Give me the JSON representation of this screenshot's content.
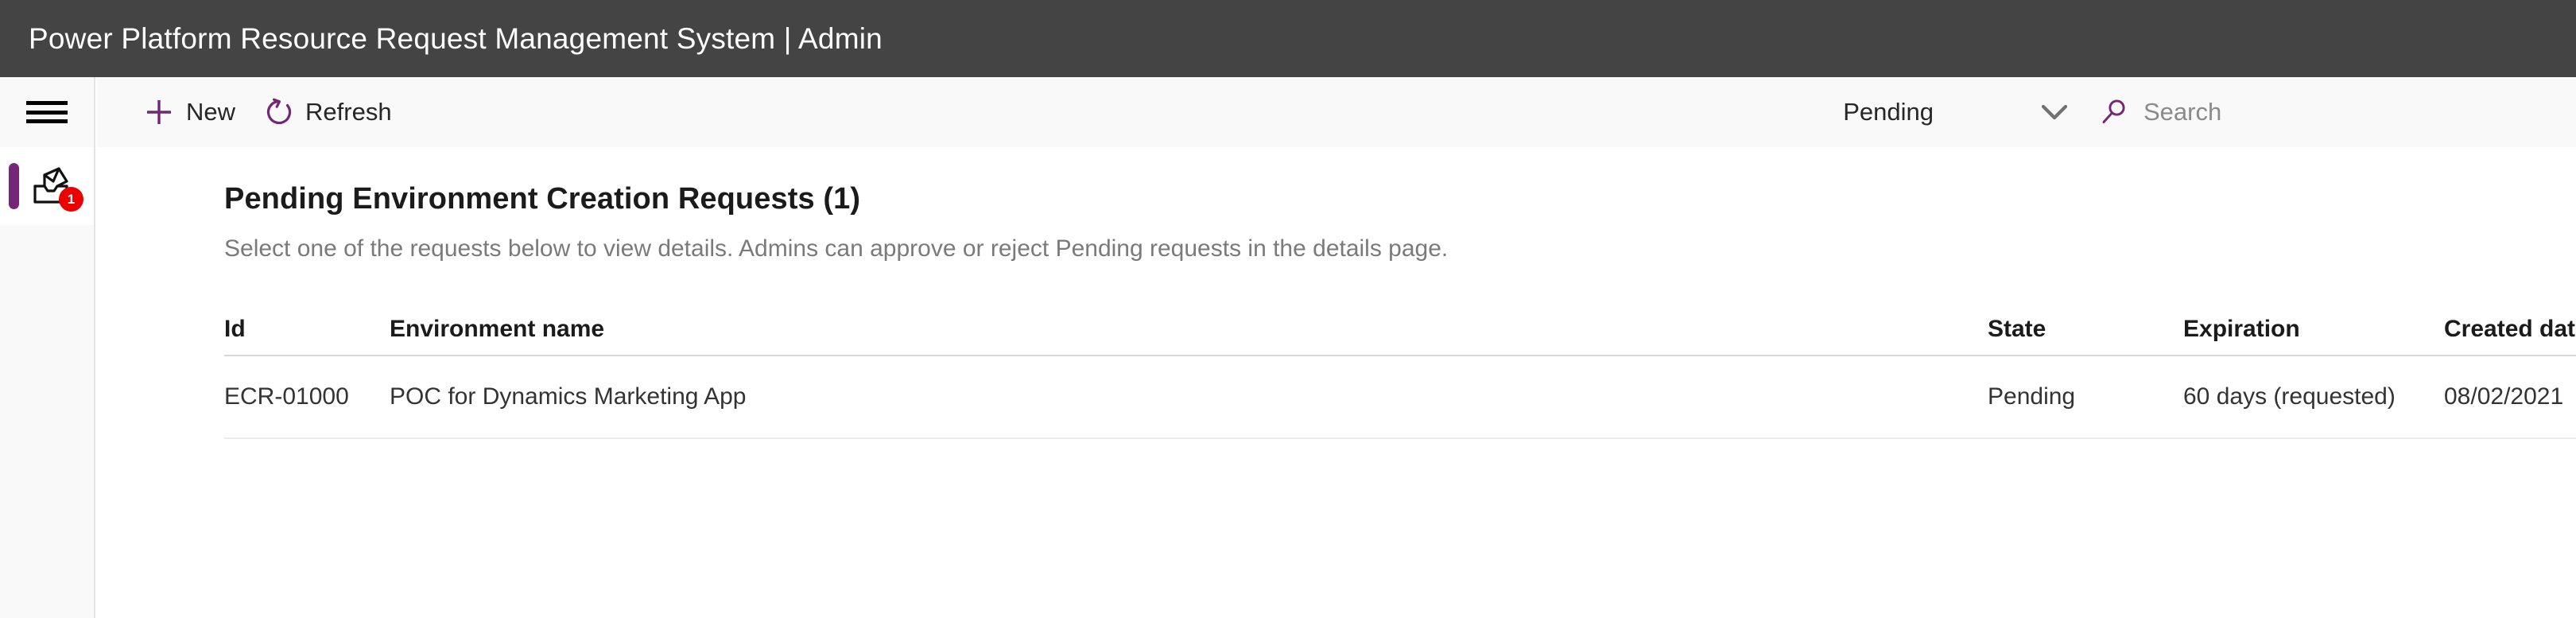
{
  "header": {
    "title": "Power Platform Resource Request Management System | Admin"
  },
  "rail": {
    "menu_icon": "hamburger-menu-icon",
    "item": {
      "icon": "inbox-tray-icon",
      "badge": "1"
    }
  },
  "commandbar": {
    "new": {
      "label": "New",
      "icon": "plus-icon"
    },
    "refresh": {
      "label": "Refresh",
      "icon": "refresh-icon"
    },
    "filter": {
      "value": "Pending",
      "icon": "chevron-down-icon"
    },
    "search": {
      "placeholder": "Search",
      "icon": "search-icon"
    }
  },
  "main": {
    "title": "Pending Environment Creation Requests (1)",
    "subtitle": "Select one of the requests below to view details. Admins can approve or reject Pending requests in the details page."
  },
  "table": {
    "columns": [
      "Id",
      "Environment name",
      "State",
      "Expiration",
      "Created date"
    ],
    "rows": [
      {
        "id": "ECR-01000",
        "name": "POC for Dynamics Marketing App",
        "state": "Pending",
        "expiration": "60 days (requested)",
        "created": "08/02/2021"
      }
    ]
  },
  "colors": {
    "header_bg": "#444444",
    "accent_purple": "#76267a",
    "badge_red": "#ec0000",
    "chrome_bg": "#f9f9f9"
  }
}
